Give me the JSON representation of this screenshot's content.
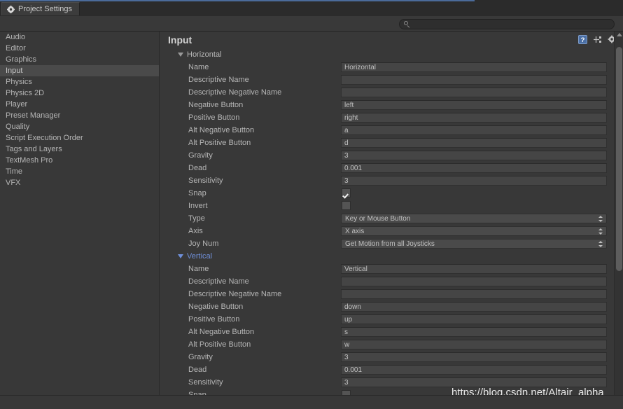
{
  "window": {
    "minimize_maximize_icon": "restore-icon",
    "close_icon": "close-icon",
    "menu_icon": "window-menu-icon"
  },
  "tab": {
    "label": "Project Settings",
    "icon": "gear-icon"
  },
  "search": {
    "value": "",
    "placeholder": "",
    "icon": "search-icon"
  },
  "sidebar": {
    "items": [
      {
        "label": "Audio",
        "selected": false
      },
      {
        "label": "Editor",
        "selected": false
      },
      {
        "label": "Graphics",
        "selected": false
      },
      {
        "label": "Input",
        "selected": true
      },
      {
        "label": "Physics",
        "selected": false
      },
      {
        "label": "Physics 2D",
        "selected": false
      },
      {
        "label": "Player",
        "selected": false
      },
      {
        "label": "Preset Manager",
        "selected": false
      },
      {
        "label": "Quality",
        "selected": false
      },
      {
        "label": "Script Execution Order",
        "selected": false
      },
      {
        "label": "Tags and Layers",
        "selected": false
      },
      {
        "label": "TextMesh Pro",
        "selected": false
      },
      {
        "label": "Time",
        "selected": false
      },
      {
        "label": "VFX",
        "selected": false
      }
    ]
  },
  "main": {
    "title": "Input",
    "header_icons": [
      {
        "name": "help-icon"
      },
      {
        "name": "preset-icon"
      },
      {
        "name": "settings-gear-icon"
      }
    ],
    "rows": [
      {
        "kind": "foldout",
        "label": "Horizontal",
        "expanded": true,
        "highlighted": false
      },
      {
        "kind": "text",
        "label": "Name",
        "value": "Horizontal"
      },
      {
        "kind": "text",
        "label": "Descriptive Name",
        "value": ""
      },
      {
        "kind": "text",
        "label": "Descriptive Negative Name",
        "value": ""
      },
      {
        "kind": "text",
        "label": "Negative Button",
        "value": "left"
      },
      {
        "kind": "text",
        "label": "Positive Button",
        "value": "right"
      },
      {
        "kind": "text",
        "label": "Alt Negative Button",
        "value": "a"
      },
      {
        "kind": "text",
        "label": "Alt Positive Button",
        "value": "d"
      },
      {
        "kind": "text",
        "label": "Gravity",
        "value": "3"
      },
      {
        "kind": "text",
        "label": "Dead",
        "value": "0.001"
      },
      {
        "kind": "text",
        "label": "Sensitivity",
        "value": "3"
      },
      {
        "kind": "check",
        "label": "Snap",
        "checked": true
      },
      {
        "kind": "check",
        "label": "Invert",
        "checked": false
      },
      {
        "kind": "popup",
        "label": "Type",
        "value": "Key or Mouse Button"
      },
      {
        "kind": "popup",
        "label": "Axis",
        "value": "X axis"
      },
      {
        "kind": "popup",
        "label": "Joy Num",
        "value": "Get Motion from all Joysticks"
      },
      {
        "kind": "foldout",
        "label": "Vertical",
        "expanded": true,
        "highlighted": true
      },
      {
        "kind": "text",
        "label": "Name",
        "value": "Vertical"
      },
      {
        "kind": "text",
        "label": "Descriptive Name",
        "value": ""
      },
      {
        "kind": "text",
        "label": "Descriptive Negative Name",
        "value": ""
      },
      {
        "kind": "text",
        "label": "Negative Button",
        "value": "down"
      },
      {
        "kind": "text",
        "label": "Positive Button",
        "value": "up"
      },
      {
        "kind": "text",
        "label": "Alt Negative Button",
        "value": "s"
      },
      {
        "kind": "text",
        "label": "Alt Positive Button",
        "value": "w"
      },
      {
        "kind": "text",
        "label": "Gravity",
        "value": "3"
      },
      {
        "kind": "text",
        "label": "Dead",
        "value": "0.001"
      },
      {
        "kind": "text",
        "label": "Sensitivity",
        "value": "3"
      },
      {
        "kind": "check",
        "label": "Snap",
        "checked": true
      }
    ]
  },
  "watermark": {
    "text": "https://blog.csdn.net/Altair_alpha"
  },
  "colors": {
    "background": "#383838",
    "panel": "#2b2b2b",
    "accent": "#4b6b9a",
    "selection": "#4a4a4a",
    "highlight_text": "#6f8fd8",
    "field": "#454545",
    "text": "#b6b6b6"
  }
}
